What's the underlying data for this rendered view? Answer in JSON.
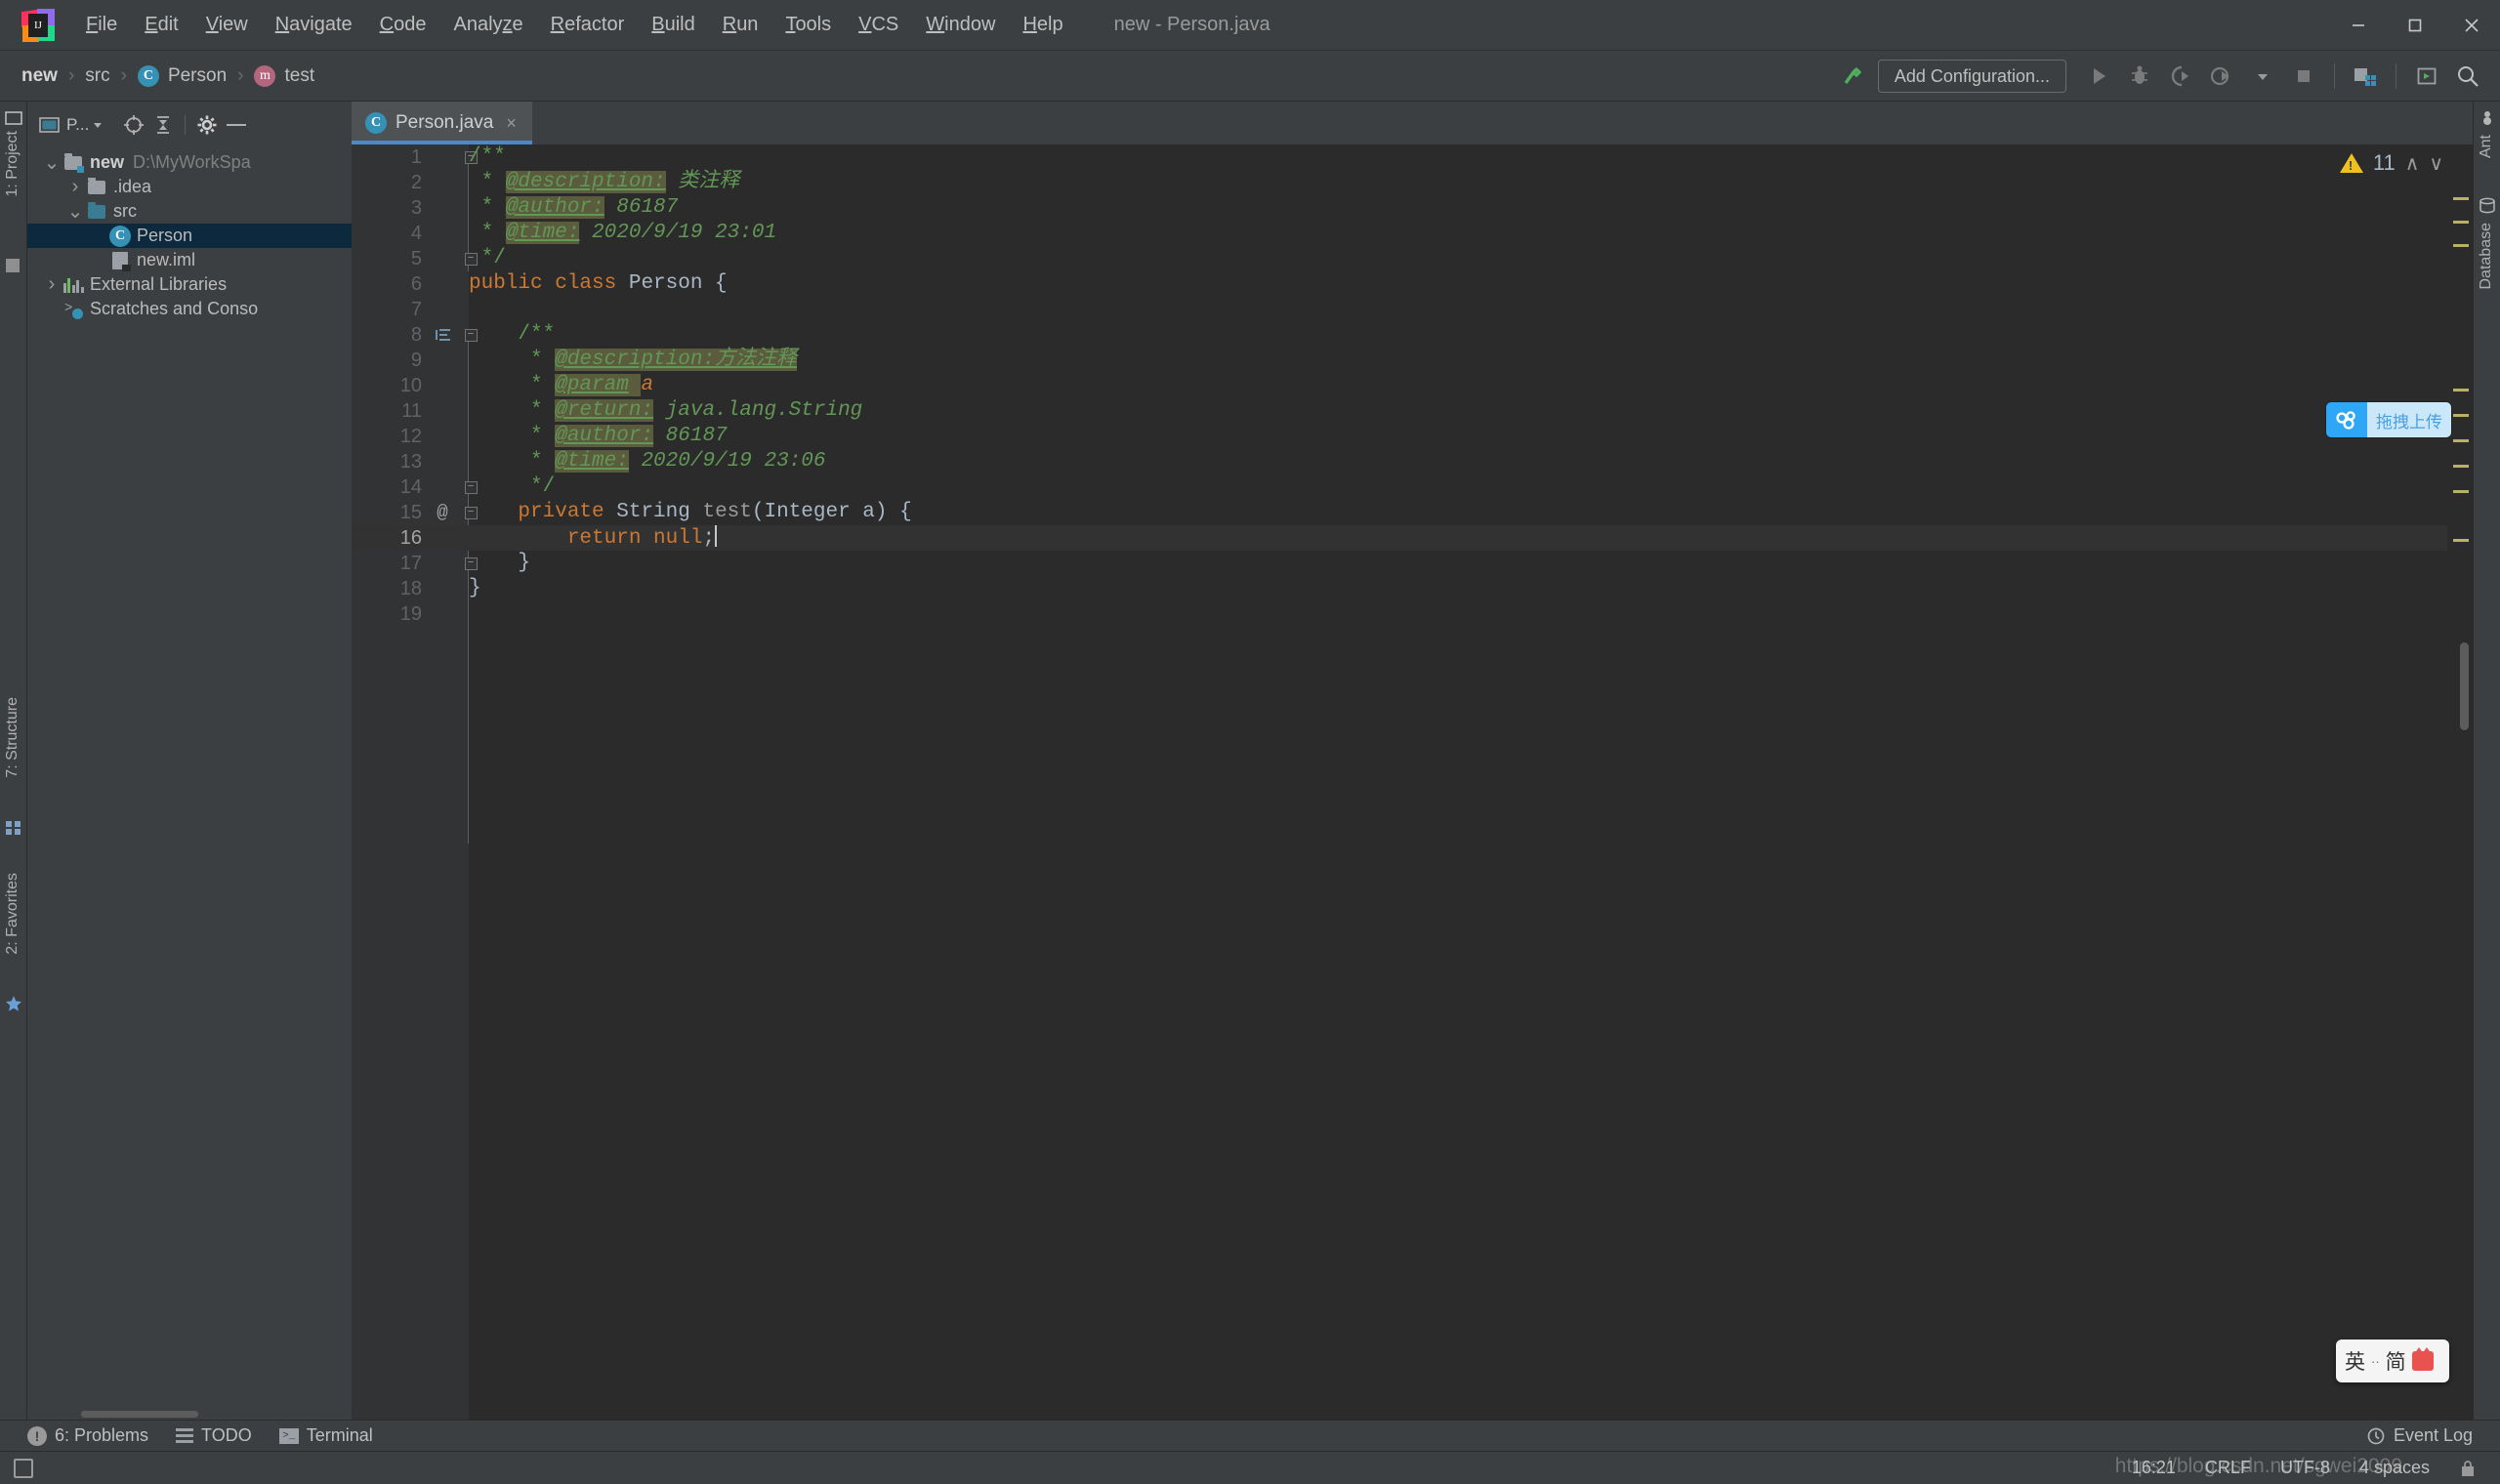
{
  "window": {
    "title": "new - Person.java",
    "controls": [
      "minimize",
      "maximize",
      "close"
    ]
  },
  "menu": {
    "items": [
      {
        "label": "File",
        "mnemonic": "F"
      },
      {
        "label": "Edit",
        "mnemonic": "E"
      },
      {
        "label": "View",
        "mnemonic": "V"
      },
      {
        "label": "Navigate",
        "mnemonic": "N"
      },
      {
        "label": "Code",
        "mnemonic": "C"
      },
      {
        "label": "Analyze",
        "mnemonic": "z"
      },
      {
        "label": "Refactor",
        "mnemonic": "R"
      },
      {
        "label": "Build",
        "mnemonic": "B"
      },
      {
        "label": "Run",
        "mnemonic": "R"
      },
      {
        "label": "Tools",
        "mnemonic": "T"
      },
      {
        "label": "VCS",
        "mnemonic": "V"
      },
      {
        "label": "Window",
        "mnemonic": "W"
      },
      {
        "label": "Help",
        "mnemonic": "H"
      }
    ]
  },
  "navbar": {
    "breadcrumbs": [
      {
        "label": "new",
        "icon": "none"
      },
      {
        "label": "src",
        "icon": "none"
      },
      {
        "label": "Person",
        "icon": "class-icon"
      },
      {
        "label": "test",
        "icon": "method-icon"
      }
    ],
    "separator": "›",
    "add_configuration_label": "Add Configuration...",
    "icons": [
      "build-hammer-icon",
      "run-icon",
      "debug-icon",
      "run-coverage-icon",
      "profiler-icon",
      "dropdown-icon",
      "stop-icon",
      "project-structure-icon",
      "terminal-icon",
      "search-everywhere-icon"
    ]
  },
  "left_stripe": {
    "top_label": "1: Project",
    "bottom_labels": [
      "7: Structure",
      "2: Favorites"
    ]
  },
  "right_stripe": {
    "labels": [
      "Ant",
      "Database"
    ]
  },
  "project_panel": {
    "title": "P...",
    "toolbar_icons": [
      "select-opened-file-icon",
      "collapse-all-icon",
      "settings-gear-icon",
      "hide-icon"
    ],
    "tree": [
      {
        "label": "new",
        "suffix": "D:\\MyWorkSpa",
        "icon": "module-folder-icon",
        "indent": 0,
        "arrow": "expanded",
        "bold": true,
        "selected": false
      },
      {
        "label": ".idea",
        "suffix": "",
        "icon": "folder-icon",
        "indent": 1,
        "arrow": "collapsed",
        "bold": false,
        "selected": false
      },
      {
        "label": "src",
        "suffix": "",
        "icon": "source-folder-icon",
        "indent": 1,
        "arrow": "expanded",
        "bold": false,
        "selected": false
      },
      {
        "label": "Person",
        "suffix": "",
        "icon": "class-icon",
        "indent": 2,
        "arrow": "none",
        "bold": false,
        "selected": true
      },
      {
        "label": "new.iml",
        "suffix": "",
        "icon": "iml-file-icon",
        "indent": 2,
        "arrow": "none",
        "bold": false,
        "selected": false
      },
      {
        "label": "External Libraries",
        "suffix": "",
        "icon": "libraries-icon",
        "indent": 0,
        "arrow": "collapsed",
        "bold": false,
        "selected": false
      },
      {
        "label": "Scratches and Conso",
        "suffix": "",
        "icon": "scratches-icon",
        "indent": 0,
        "arrow": "none",
        "bold": false,
        "selected": false
      }
    ]
  },
  "editor": {
    "tab": {
      "label": "Person.java",
      "icon": "class-icon",
      "close": "×"
    },
    "inspection": {
      "warning_count": "11",
      "icon": "warning-triangle-icon",
      "up": "∧",
      "down": "∨"
    },
    "caret_line": 16,
    "lines": [
      {
        "n": "1",
        "segs": [
          {
            "t": "/**",
            "c": "cmtp"
          }
        ],
        "indent": 0,
        "fold": "start",
        "gutter": ""
      },
      {
        "n": "2",
        "segs": [
          {
            "t": " * ",
            "c": "cmtp"
          },
          {
            "t": "@description:",
            "c": "tag"
          },
          {
            "t": " 类注释",
            "c": "tagval"
          }
        ],
        "indent": 0,
        "fold": "",
        "gutter": ""
      },
      {
        "n": "3",
        "segs": [
          {
            "t": " * ",
            "c": "cmtp"
          },
          {
            "t": "@author:",
            "c": "tag"
          },
          {
            "t": " 86187",
            "c": "tagval"
          }
        ],
        "indent": 0,
        "fold": "",
        "gutter": ""
      },
      {
        "n": "4",
        "segs": [
          {
            "t": " * ",
            "c": "cmtp"
          },
          {
            "t": "@time:",
            "c": "tag"
          },
          {
            "t": " 2020/9/19 23:01",
            "c": "tagval"
          }
        ],
        "indent": 0,
        "fold": "",
        "gutter": ""
      },
      {
        "n": "5",
        "segs": [
          {
            "t": " */",
            "c": "cmtp"
          }
        ],
        "indent": 0,
        "fold": "end",
        "gutter": ""
      },
      {
        "n": "6",
        "segs": [
          {
            "t": "public class",
            "c": "kw"
          },
          {
            "t": " Person {",
            "c": "cls"
          }
        ],
        "indent": 0,
        "fold": "",
        "gutter": ""
      },
      {
        "n": "7",
        "segs": [],
        "indent": 0,
        "fold": "",
        "gutter": ""
      },
      {
        "n": "8",
        "segs": [
          {
            "t": "    /**",
            "c": "cmtp"
          }
        ],
        "indent": 0,
        "fold": "start",
        "gutter": "implemented-icon"
      },
      {
        "n": "9",
        "segs": [
          {
            "t": "     * ",
            "c": "cmtp"
          },
          {
            "t": "@description:方法注释",
            "c": "tag"
          }
        ],
        "indent": 0,
        "fold": "",
        "gutter": ""
      },
      {
        "n": "10",
        "segs": [
          {
            "t": "     * ",
            "c": "cmtp"
          },
          {
            "t": "@param",
            "c": "tag"
          },
          {
            "t": " ",
            "c": "hl"
          },
          {
            "t": "a",
            "c": "param"
          }
        ],
        "indent": 0,
        "fold": "",
        "gutter": ""
      },
      {
        "n": "11",
        "segs": [
          {
            "t": "     * ",
            "c": "cmtp"
          },
          {
            "t": "@return:",
            "c": "tag"
          },
          {
            "t": " java.lang.String",
            "c": "tagval"
          }
        ],
        "indent": 0,
        "fold": "",
        "gutter": ""
      },
      {
        "n": "12",
        "segs": [
          {
            "t": "     * ",
            "c": "cmtp"
          },
          {
            "t": "@author:",
            "c": "tag"
          },
          {
            "t": " 86187",
            "c": "tagval"
          }
        ],
        "indent": 0,
        "fold": "",
        "gutter": ""
      },
      {
        "n": "13",
        "segs": [
          {
            "t": "     * ",
            "c": "cmtp"
          },
          {
            "t": "@time:",
            "c": "tag"
          },
          {
            "t": " 2020/9/19 23:06",
            "c": "tagval"
          }
        ],
        "indent": 0,
        "fold": "",
        "gutter": ""
      },
      {
        "n": "14",
        "segs": [
          {
            "t": "     */",
            "c": "cmtp"
          }
        ],
        "indent": 0,
        "fold": "end",
        "gutter": ""
      },
      {
        "n": "15",
        "segs": [
          {
            "t": "    ",
            "c": "cls"
          },
          {
            "t": "private",
            "c": "kw"
          },
          {
            "t": " String ",
            "c": "cls"
          },
          {
            "t": "test",
            "c": "mth"
          },
          {
            "t": "(Integer a) {",
            "c": "cls"
          }
        ],
        "indent": 0,
        "fold": "start",
        "gutter": "@"
      },
      {
        "n": "16",
        "segs": [
          {
            "t": "        ",
            "c": "cls"
          },
          {
            "t": "return null",
            "c": "kw"
          },
          {
            "t": ";",
            "c": "cls"
          }
        ],
        "indent": 0,
        "fold": "",
        "gutter": "",
        "caret": true
      },
      {
        "n": "17",
        "segs": [
          {
            "t": "    }",
            "c": "cls"
          }
        ],
        "indent": 0,
        "fold": "end",
        "gutter": ""
      },
      {
        "n": "18",
        "segs": [
          {
            "t": "}",
            "c": "cls"
          }
        ],
        "indent": 0,
        "fold": "",
        "gutter": ""
      },
      {
        "n": "19",
        "segs": [],
        "indent": 0,
        "fold": "",
        "gutter": ""
      }
    ]
  },
  "upload_widget": {
    "label": "拖拽上传",
    "icon": "baidu-netdisk-icon",
    "accent": "#2ea7f7"
  },
  "ime_widget": {
    "mode": "英",
    "dots": "··",
    "shape": "简",
    "icon": "sogou-fox-icon"
  },
  "toolwindow_bar": {
    "items": [
      {
        "label": "6: Problems",
        "mnemonic": "6",
        "icon": "problems-icon"
      },
      {
        "label": "TODO",
        "mnemonic": "",
        "icon": "todo-icon"
      },
      {
        "label": "Terminal",
        "mnemonic": "",
        "icon": "terminal-icon"
      }
    ],
    "right": {
      "label": "Event Log",
      "icon": "event-log-icon"
    }
  },
  "statusbar": {
    "position": "16:21",
    "line_separator": "CRLF",
    "encoding": "UTF-8",
    "indent": "4 spaces",
    "lock_icon": "lock-icon",
    "watermark": "https://blog.csdn.net/sgwei2009"
  }
}
